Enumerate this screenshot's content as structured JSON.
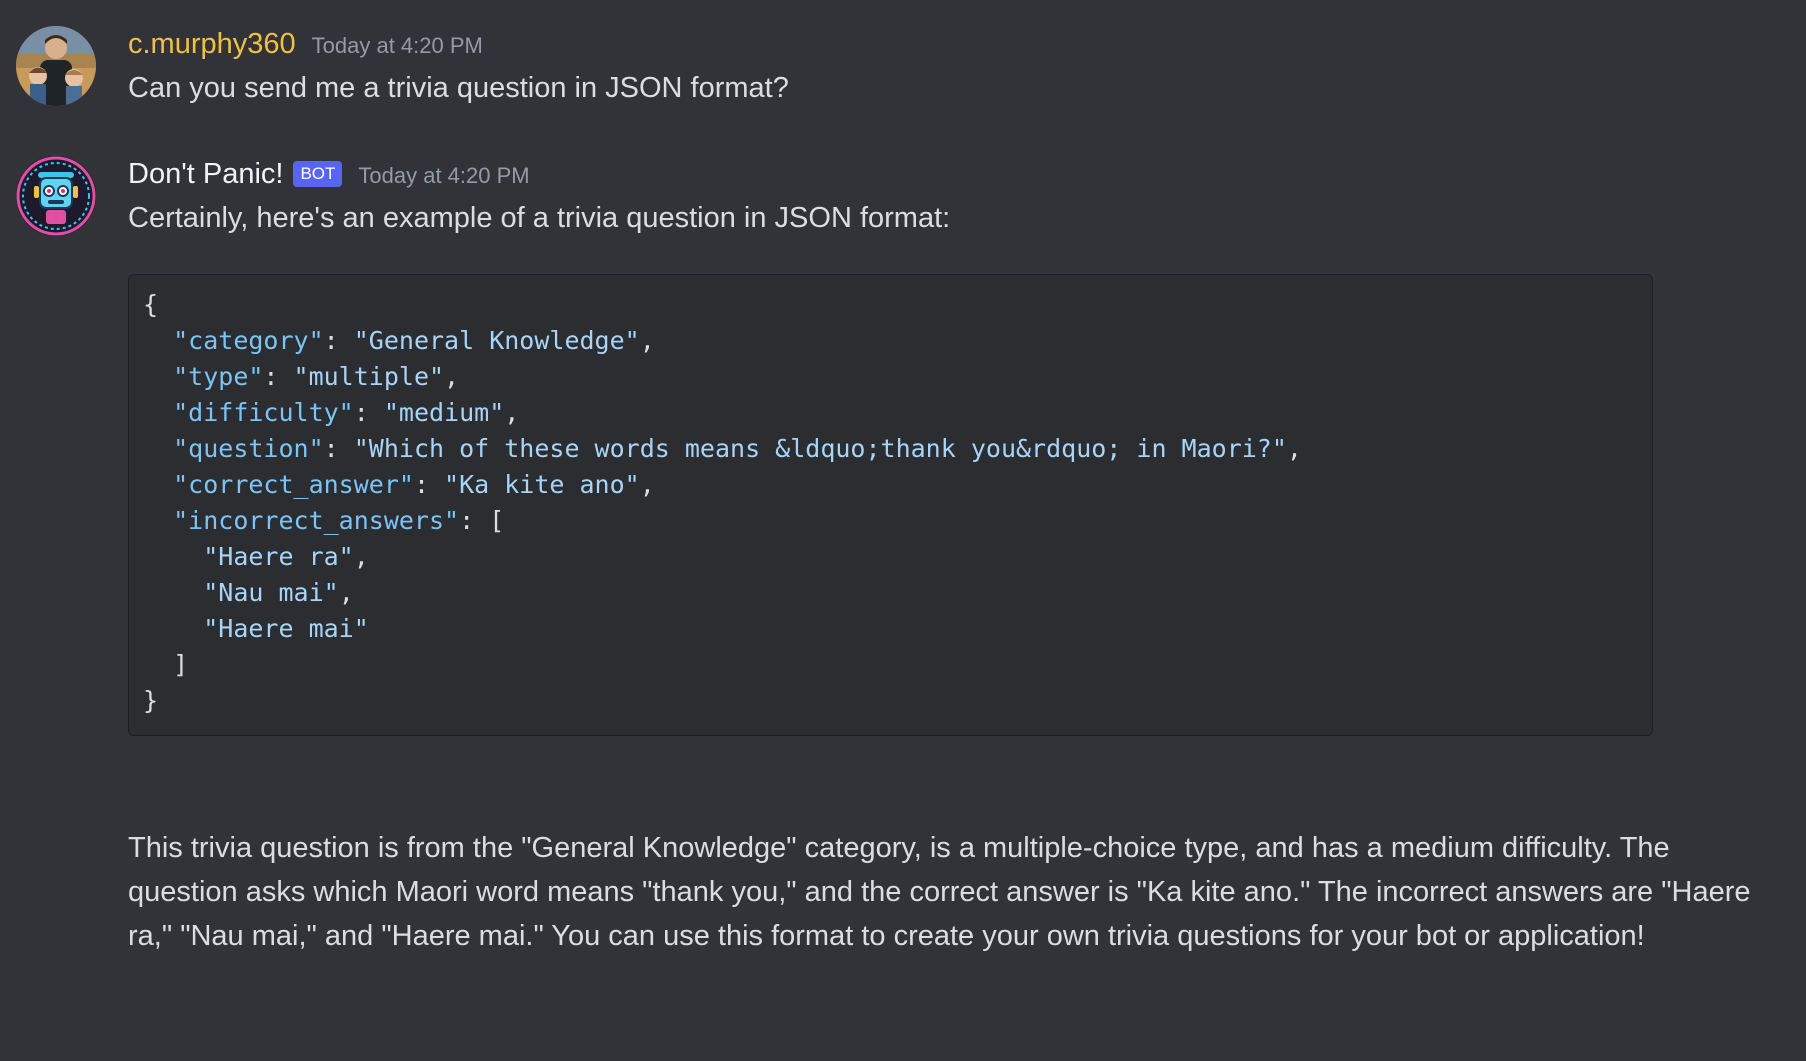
{
  "messages": {
    "user": {
      "username": "c.murphy360",
      "timestamp": "Today at 4:20 PM",
      "text": "Can you send me a trivia question in JSON format?",
      "avatar_icon": "family-photo-avatar",
      "name_color": "#f0c040"
    },
    "bot": {
      "username": "Don't Panic!",
      "bot_tag": "BOT",
      "timestamp": "Today at 4:20 PM",
      "intro": "Certainly, here's an example of a trivia question in JSON format:",
      "avatar_icon": "robot-avatar",
      "code": {
        "open_brace": "{",
        "category_key": "\"category\"",
        "category_value": "\"General Knowledge\"",
        "type_key": "\"type\"",
        "type_value": "\"multiple\"",
        "difficulty_key": "\"difficulty\"",
        "difficulty_value": "\"medium\"",
        "question_key": "\"question\"",
        "question_value": "\"Which of these words means &ldquo;thank you&rdquo; in Maori?\"",
        "correct_key": "\"correct_answer\"",
        "correct_value": "\"Ka kite ano\"",
        "incorrect_key": "\"incorrect_answers\"",
        "incorrect_1": "\"Haere ra\"",
        "incorrect_2": "\"Nau mai\"",
        "incorrect_3": "\"Haere mai\"",
        "close_bracket": "]",
        "close_brace": "}"
      },
      "explanation": "This trivia question is from the \"General Knowledge\" category, is a multiple-choice type, and has a medium difficulty. The question asks which Maori word means \"thank you,\" and the correct answer is \"Ka kite ano.\" The incorrect answers are \"Haere ra,\" \"Nau mai,\" and \"Haere mai.\" You can use this format to create your own trivia questions for your bot or application!"
    }
  },
  "colors": {
    "background": "#313338",
    "code_background": "#2b2d31",
    "bot_tag": "#5865f2",
    "json_key": "#7cc4f5"
  }
}
